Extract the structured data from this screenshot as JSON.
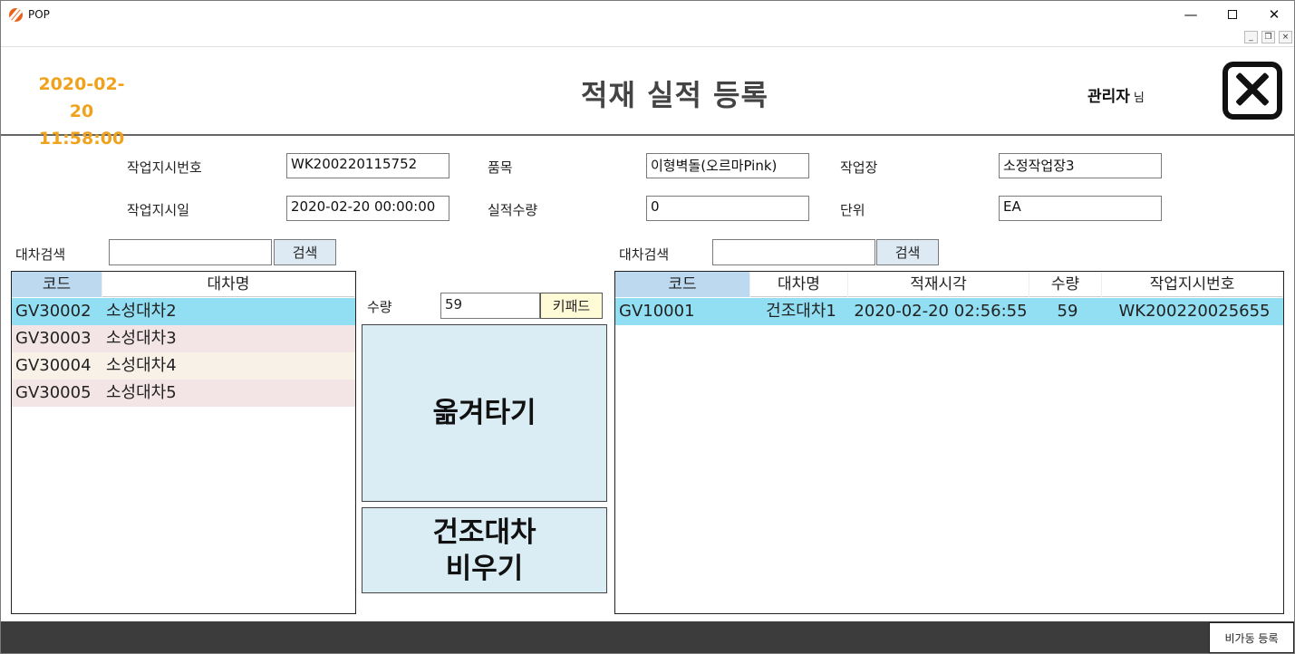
{
  "window": {
    "title": "POP"
  },
  "header": {
    "date": "2020-02-20",
    "time": "11:58:00",
    "title": "적재 실적 등록",
    "user_name": "관리자",
    "user_suffix": "님"
  },
  "form": {
    "work_order_no_label": "작업지시번호",
    "work_order_no": "WK200220115752",
    "item_label": "품목",
    "item": "이형벽돌(오르마Pink)",
    "workplace_label": "작업장",
    "workplace": "소정작업장3",
    "work_order_date_label": "작업지시일",
    "work_order_date": "2020-02-20 00:00:00",
    "result_qty_label": "실적수량",
    "result_qty": "0",
    "unit_label": "단위",
    "unit": "EA"
  },
  "left": {
    "search_label": "대차검색",
    "search_value": "",
    "search_button": "검색",
    "columns": [
      "코드",
      "대차명"
    ],
    "rows": [
      {
        "code": "GV30002",
        "name": "소성대차2",
        "bg": "#92dff3"
      },
      {
        "code": "GV30003",
        "name": "소성대차3",
        "bg": "#f3e4e6"
      },
      {
        "code": "GV30004",
        "name": "소성대차4",
        "bg": "#f7f1e8"
      },
      {
        "code": "GV30005",
        "name": "소성대차5",
        "bg": "#f3e4e6"
      }
    ]
  },
  "middle": {
    "qty_label": "수량",
    "qty_value": "59",
    "keypad_button": "키패드",
    "move_button": "옮겨타기",
    "empty_button_line1": "건조대차",
    "empty_button_line2": "비우기"
  },
  "right": {
    "search_label": "대차검색",
    "search_value": "",
    "search_button": "검색",
    "columns": [
      "코드",
      "대차명",
      "적재시각",
      "수량",
      "작업지시번호"
    ],
    "rows": [
      {
        "code": "GV10001",
        "name": "건조대차1",
        "loaded_at": "2020-02-20 02:56:55",
        "qty": "59",
        "work_order_no": "WK200220025655",
        "bg": "#92dff3"
      }
    ]
  },
  "footer": {
    "downtime_button": "비가동 등록"
  },
  "colors": {
    "accent": "#f0a21c",
    "selected_row": "#92dff3",
    "button_bg": "#daedf5",
    "footer_bg": "#3c3c3c"
  }
}
